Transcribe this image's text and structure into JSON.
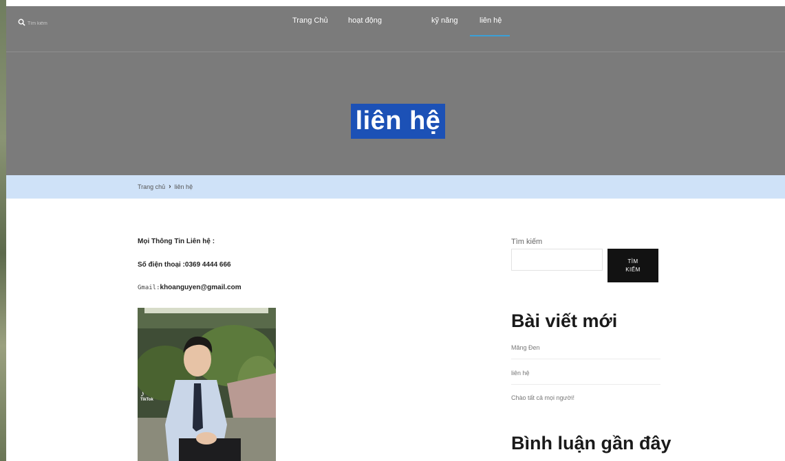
{
  "header": {
    "search_placeholder": "Tìm kiếm",
    "nav": [
      {
        "label": "Trang Chủ"
      },
      {
        "label": "hoạt động"
      },
      {
        "label": "kỹ năng"
      },
      {
        "label": "liên hệ",
        "active": true
      }
    ],
    "active_color": "#3aa0d8"
  },
  "page": {
    "title": "liên hệ",
    "title_bg_color": "#1c51b6"
  },
  "breadcrumb": {
    "home": "Trang chủ",
    "current": "liên hệ"
  },
  "contact": {
    "heading": "Mọi Thông Tin Liên hệ :",
    "phone_line": "Số điện thoại :0369 4444 666",
    "gmail_label": "Gmail:",
    "gmail_value": "khoanguyen@gmail.com",
    "photo_watermark": "TikTok"
  },
  "sidebar": {
    "search_label": "Tìm kiếm",
    "search_button_line1": "TÌM",
    "search_button_line2": "KIẾM",
    "recent_title": "Bài viết mới",
    "recent_posts": [
      {
        "title": "Măng Đen"
      },
      {
        "title": "liên hệ"
      },
      {
        "title": "Chào tất cả mọi người!"
      }
    ],
    "comments_title": "Bình luận gần đây"
  }
}
